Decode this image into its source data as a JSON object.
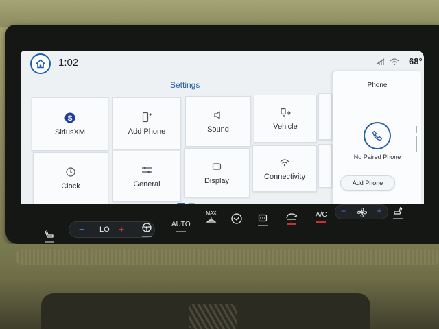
{
  "status_bar": {
    "time": "1:02",
    "temperature": "68°",
    "icons": [
      "home-icon",
      "mute-icon",
      "wifi-icon"
    ]
  },
  "settings": {
    "title": "Settings",
    "tiles": [
      {
        "label": "SiriusXM",
        "icon": "siriusxm-icon"
      },
      {
        "label": "Add Phone",
        "icon": "add-phone-icon"
      },
      {
        "label": "Sound",
        "icon": "sound-icon"
      },
      {
        "label": "Vehicle",
        "icon": "vehicle-icon"
      },
      {
        "label": "Clock",
        "icon": "clock-icon"
      },
      {
        "label": "General",
        "icon": "sliders-icon"
      },
      {
        "label": "Display",
        "icon": "display-icon"
      },
      {
        "label": "Connectivity",
        "icon": "wifi-icon"
      }
    ]
  },
  "phone_panel": {
    "title": "Phone",
    "status": "No Paired Phone",
    "button": "Add Phone"
  },
  "hvac": {
    "driver_temp": "LO",
    "minus": "−",
    "plus": "+",
    "auto": "AUTO",
    "max": "MAX",
    "ac": "A/C",
    "accent_blue": "#4b7fd0",
    "accent_red": "#d23b35"
  }
}
